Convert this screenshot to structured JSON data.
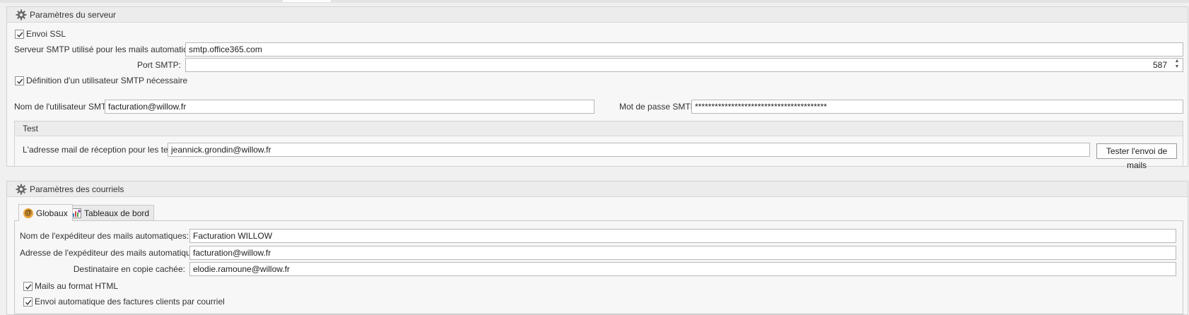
{
  "server_section": {
    "title": "Paramètres du serveur",
    "ssl_label": "Envoi SSL",
    "ssl_checked": true,
    "smtp_server_label": "Serveur SMTP utilisé pour les mails automatiques:",
    "smtp_server_value": "smtp.office365.com",
    "smtp_port_label": "Port SMTP:",
    "smtp_port_value": "587",
    "auth_required_label": "Définition d'un utilisateur SMTP nécessaire",
    "auth_required_checked": true,
    "username_label": "Nom de l'utilisateur SMTP:",
    "username_value": "facturation@willow.fr",
    "password_label": "Mot de passe SMTP:",
    "password_value": "****************************************",
    "test": {
      "title": "Test",
      "address_label": "L'adresse mail de réception pour les tests:",
      "address_value": "jeannick.grondin@willow.fr",
      "button_label": "Tester l'envoi de mails"
    }
  },
  "mail_section": {
    "title": "Paramètres des courriels",
    "tabs": [
      {
        "label": "Globaux",
        "icon": "at-mail-icon",
        "active": true
      },
      {
        "label": "Tableaux de bord",
        "icon": "dashboard-icon",
        "active": false
      }
    ],
    "sender_name_label": "Nom de l'expéditeur des mails automatiques:",
    "sender_name_value": "Facturation WILLOW",
    "sender_address_label": "Adresse de l'expéditeur des mails automatiques:",
    "sender_address_value": "facturation@willow.fr",
    "bcc_label": "Destinataire en copie cachée:",
    "bcc_value": "elodie.ramoune@willow.fr",
    "html_format_label": "Mails au format HTML",
    "html_format_checked": true,
    "auto_invoice_label": "Envoi automatique des factures clients par courriel",
    "auto_invoice_checked": true
  },
  "colors": {
    "background": "#f0f0f0",
    "header": "#ececec",
    "border": "#d2d2d2",
    "input_border": "#b8b8b8"
  }
}
